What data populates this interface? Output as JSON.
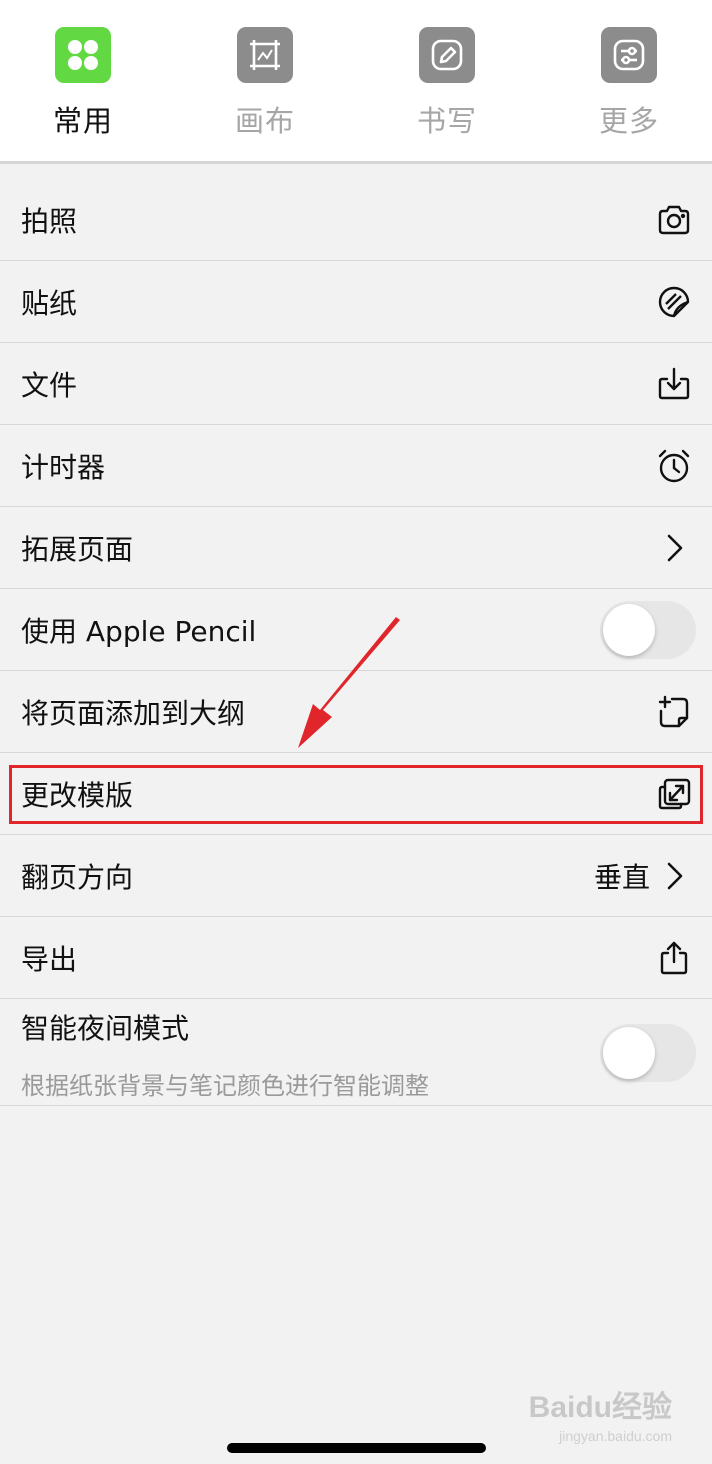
{
  "tabs": [
    {
      "label": "常用",
      "icon": "grid-icon",
      "active": true
    },
    {
      "label": "画布",
      "icon": "canvas-frame-icon",
      "active": false
    },
    {
      "label": "书写",
      "icon": "pencil-icon",
      "active": false
    },
    {
      "label": "更多",
      "icon": "sliders-icon",
      "active": false
    }
  ],
  "menu": {
    "photo": {
      "label": "拍照",
      "icon": "camera-icon"
    },
    "sticker": {
      "label": "贴纸",
      "icon": "sticker-icon"
    },
    "file": {
      "label": "文件",
      "icon": "download-tray-icon"
    },
    "timer": {
      "label": "计时器",
      "icon": "alarm-clock-icon"
    },
    "extend_page": {
      "label": "拓展页面",
      "icon": "chevron-right-icon"
    },
    "apple_pencil": {
      "label": "使用 Apple Pencil",
      "toggle_on": false
    },
    "add_to_outline": {
      "label": "将页面添加到大纲",
      "icon": "add-outline-icon"
    },
    "change_template": {
      "label": "更改模版",
      "icon": "change-template-icon",
      "highlighted": true
    },
    "page_direction": {
      "label": "翻页方向",
      "value": "垂直",
      "icon": "chevron-right-icon"
    },
    "export": {
      "label": "导出",
      "icon": "share-icon"
    },
    "night_mode": {
      "label": "智能夜间模式",
      "sub_label": "根据纸张背景与笔记颜色进行智能调整",
      "toggle_on": false
    }
  },
  "colors": {
    "active_tab_icon": "#62d842",
    "inactive_tab_icon": "#8c8c8c",
    "annotation_red": "#e0262b"
  },
  "watermark": {
    "brand": "Baidu经验",
    "url": "jingyan.baidu.com"
  }
}
